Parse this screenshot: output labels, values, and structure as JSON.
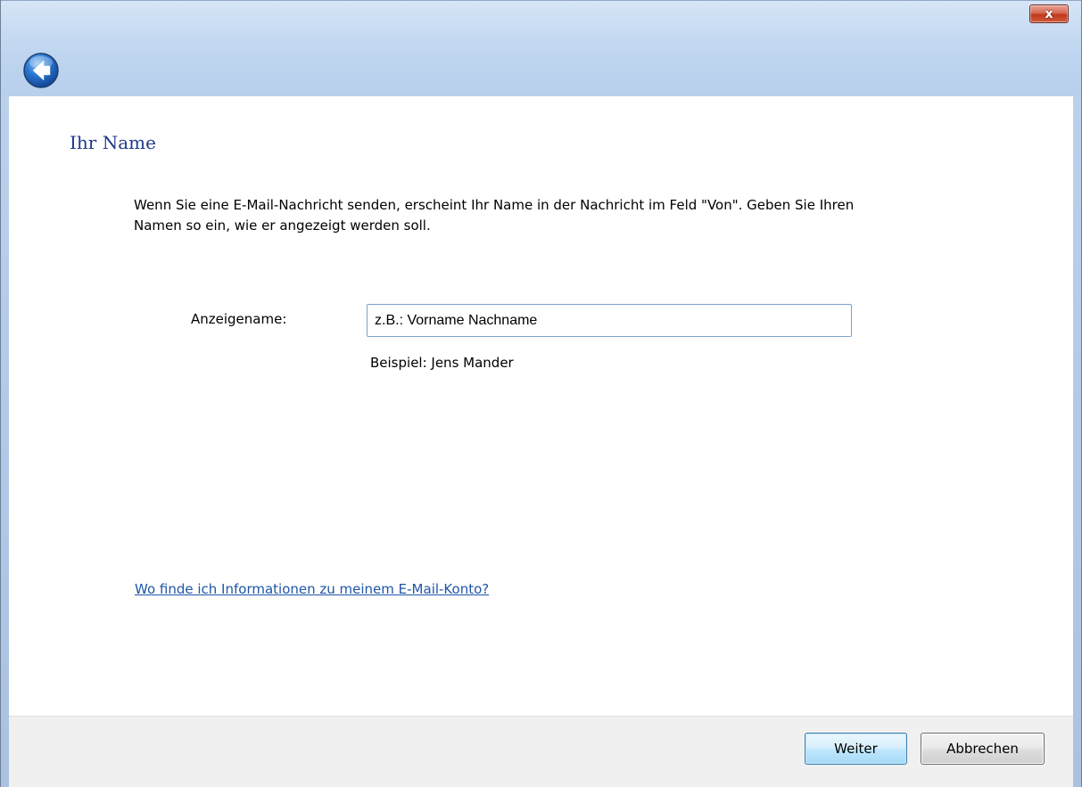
{
  "titlebar": {
    "close_label": "x",
    "back_icon": "back-arrow-icon",
    "close_icon": "close-icon"
  },
  "page": {
    "title": "Ihr Name",
    "intro": "Wenn Sie eine E-Mail-Nachricht senden, erscheint Ihr Name in der Nachricht im Feld \"Von\". Geben Sie Ihren Namen so ein, wie er angezeigt werden soll."
  },
  "form": {
    "display_name_label": "Anzeigename:",
    "display_name_value": "z.B.: Vorname Nachname",
    "example": "Beispiel: Jens Mander"
  },
  "help": {
    "link_text": "Wo finde ich Informationen zu meinem E-Mail-Konto?"
  },
  "footer": {
    "next_label": "Weiter",
    "cancel_label": "Abbrechen"
  },
  "colors": {
    "title": "#1e3a8c",
    "link": "#1f56a8",
    "titlebar": "#c6daf2",
    "close_button": "#c2391d"
  }
}
